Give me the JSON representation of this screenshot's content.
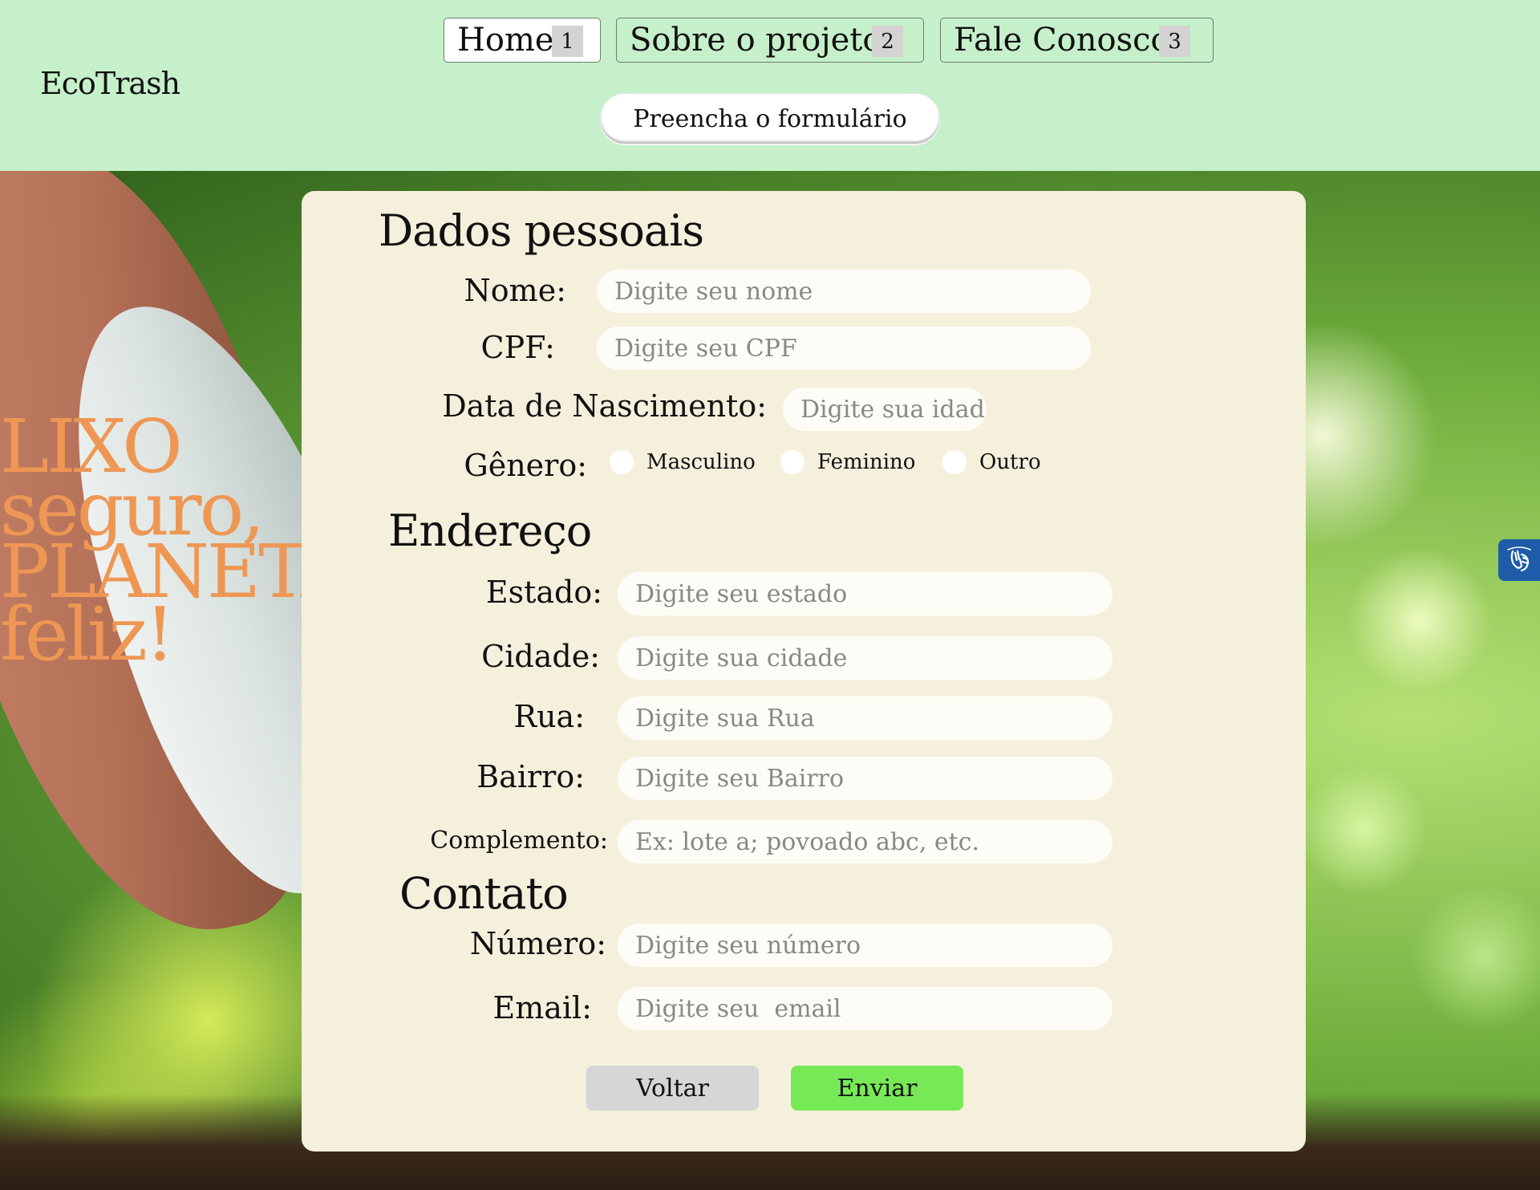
{
  "header": {
    "logo": "EcoTrash",
    "nav": [
      {
        "label": "Home",
        "num": "1"
      },
      {
        "label": "Sobre o projeto",
        "num": "2"
      },
      {
        "label": "Fale Conosco",
        "num": "3"
      }
    ],
    "cta": "Preencha o formulário"
  },
  "hero": {
    "slogan": [
      "LIXO",
      "seguro,",
      "PLANETA",
      "feliz!"
    ]
  },
  "form": {
    "personal": {
      "title": "Dados pessoais",
      "nome_label": "Nome:",
      "nome_placeholder": "Digite seu nome",
      "cpf_label": "CPF:",
      "cpf_placeholder": "Digite seu CPF",
      "nascimento_label": "Data de Nascimento:",
      "nascimento_placeholder": "Digite sua idade",
      "genero_label": "Gênero:",
      "genero_options": [
        "Masculino",
        "Feminino",
        "Outro"
      ]
    },
    "address": {
      "title": "Endereço",
      "estado_label": "Estado:",
      "estado_placeholder": "Digite seu estado",
      "cidade_label": "Cidade:",
      "cidade_placeholder": "Digite sua cidade",
      "rua_label": "Rua:",
      "rua_placeholder": "Digite sua Rua",
      "bairro_label": "Bairro:",
      "bairro_placeholder": "Digite seu Bairro",
      "complemento_label": "Complemento:",
      "complemento_placeholder": "Ex: lote a; povoado abc, etc."
    },
    "contact": {
      "title": "Contato",
      "numero_label": "Número:",
      "numero_placeholder": "Digite seu número",
      "email_label": "Email:",
      "email_placeholder": "Digite seu  email"
    },
    "buttons": {
      "back": "Voltar",
      "send": "Enviar"
    }
  },
  "colors": {
    "header_bg": "#c6f0ca",
    "card_bg": "#f5f0dc",
    "slogan": "#ee9754",
    "send_button": "#77e957",
    "back_button": "#d6d6d6",
    "a11y_widget": "#1e5ca9"
  },
  "icons": {
    "a11y": "sign-language-hands-icon"
  }
}
